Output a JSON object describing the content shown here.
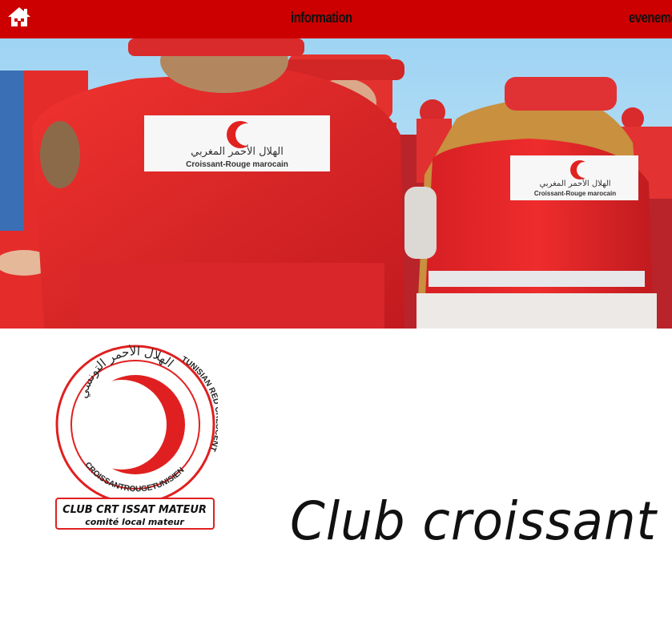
{
  "nav": {
    "home_icon": "home-icon",
    "links": [
      {
        "label": "information"
      },
      {
        "label": "evenements"
      }
    ]
  },
  "hero": {
    "patch_text_arabic": "الهلال الأحمر المغربي",
    "patch_text_latin": "Croissant-Rouge marocain"
  },
  "logo": {
    "ring_arabic": "الهلال الأحمر التونسي",
    "ring_left": "CROISSANTROUGETUNISIEN",
    "ring_right": "TUNISIAN RED CRESCENT",
    "club_name": "CLUB CRT ISSAT MATEUR",
    "club_sub": "comité local mateur"
  },
  "headline": "Club croissant r",
  "colors": {
    "nav_bg": "#cc0000",
    "brand_red": "#e02020",
    "vest_red": "#e8262a",
    "sky": "#9ed3f2"
  }
}
